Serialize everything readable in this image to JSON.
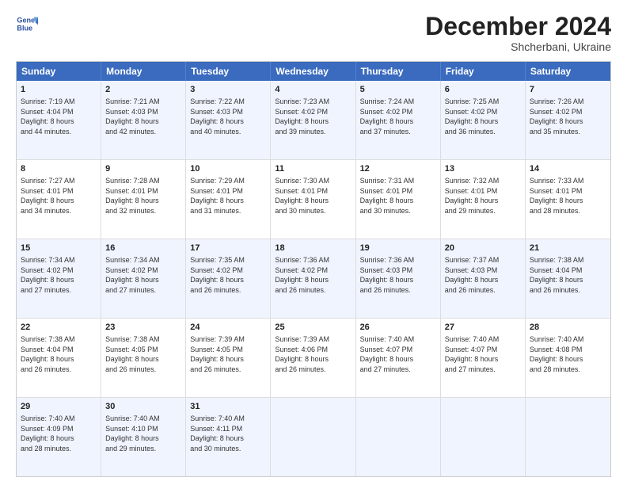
{
  "header": {
    "logo_line1": "General",
    "logo_line2": "Blue",
    "month": "December 2024",
    "location": "Shcherbani, Ukraine"
  },
  "days_of_week": [
    "Sunday",
    "Monday",
    "Tuesday",
    "Wednesday",
    "Thursday",
    "Friday",
    "Saturday"
  ],
  "weeks": [
    [
      {
        "day": "1",
        "lines": [
          "Sunrise: 7:19 AM",
          "Sunset: 4:04 PM",
          "Daylight: 8 hours",
          "and 44 minutes."
        ]
      },
      {
        "day": "2",
        "lines": [
          "Sunrise: 7:21 AM",
          "Sunset: 4:03 PM",
          "Daylight: 8 hours",
          "and 42 minutes."
        ]
      },
      {
        "day": "3",
        "lines": [
          "Sunrise: 7:22 AM",
          "Sunset: 4:03 PM",
          "Daylight: 8 hours",
          "and 40 minutes."
        ]
      },
      {
        "day": "4",
        "lines": [
          "Sunrise: 7:23 AM",
          "Sunset: 4:02 PM",
          "Daylight: 8 hours",
          "and 39 minutes."
        ]
      },
      {
        "day": "5",
        "lines": [
          "Sunrise: 7:24 AM",
          "Sunset: 4:02 PM",
          "Daylight: 8 hours",
          "and 37 minutes."
        ]
      },
      {
        "day": "6",
        "lines": [
          "Sunrise: 7:25 AM",
          "Sunset: 4:02 PM",
          "Daylight: 8 hours",
          "and 36 minutes."
        ]
      },
      {
        "day": "7",
        "lines": [
          "Sunrise: 7:26 AM",
          "Sunset: 4:02 PM",
          "Daylight: 8 hours",
          "and 35 minutes."
        ]
      }
    ],
    [
      {
        "day": "8",
        "lines": [
          "Sunrise: 7:27 AM",
          "Sunset: 4:01 PM",
          "Daylight: 8 hours",
          "and 34 minutes."
        ]
      },
      {
        "day": "9",
        "lines": [
          "Sunrise: 7:28 AM",
          "Sunset: 4:01 PM",
          "Daylight: 8 hours",
          "and 32 minutes."
        ]
      },
      {
        "day": "10",
        "lines": [
          "Sunrise: 7:29 AM",
          "Sunset: 4:01 PM",
          "Daylight: 8 hours",
          "and 31 minutes."
        ]
      },
      {
        "day": "11",
        "lines": [
          "Sunrise: 7:30 AM",
          "Sunset: 4:01 PM",
          "Daylight: 8 hours",
          "and 30 minutes."
        ]
      },
      {
        "day": "12",
        "lines": [
          "Sunrise: 7:31 AM",
          "Sunset: 4:01 PM",
          "Daylight: 8 hours",
          "and 30 minutes."
        ]
      },
      {
        "day": "13",
        "lines": [
          "Sunrise: 7:32 AM",
          "Sunset: 4:01 PM",
          "Daylight: 8 hours",
          "and 29 minutes."
        ]
      },
      {
        "day": "14",
        "lines": [
          "Sunrise: 7:33 AM",
          "Sunset: 4:01 PM",
          "Daylight: 8 hours",
          "and 28 minutes."
        ]
      }
    ],
    [
      {
        "day": "15",
        "lines": [
          "Sunrise: 7:34 AM",
          "Sunset: 4:02 PM",
          "Daylight: 8 hours",
          "and 27 minutes."
        ]
      },
      {
        "day": "16",
        "lines": [
          "Sunrise: 7:34 AM",
          "Sunset: 4:02 PM",
          "Daylight: 8 hours",
          "and 27 minutes."
        ]
      },
      {
        "day": "17",
        "lines": [
          "Sunrise: 7:35 AM",
          "Sunset: 4:02 PM",
          "Daylight: 8 hours",
          "and 26 minutes."
        ]
      },
      {
        "day": "18",
        "lines": [
          "Sunrise: 7:36 AM",
          "Sunset: 4:02 PM",
          "Daylight: 8 hours",
          "and 26 minutes."
        ]
      },
      {
        "day": "19",
        "lines": [
          "Sunrise: 7:36 AM",
          "Sunset: 4:03 PM",
          "Daylight: 8 hours",
          "and 26 minutes."
        ]
      },
      {
        "day": "20",
        "lines": [
          "Sunrise: 7:37 AM",
          "Sunset: 4:03 PM",
          "Daylight: 8 hours",
          "and 26 minutes."
        ]
      },
      {
        "day": "21",
        "lines": [
          "Sunrise: 7:38 AM",
          "Sunset: 4:04 PM",
          "Daylight: 8 hours",
          "and 26 minutes."
        ]
      }
    ],
    [
      {
        "day": "22",
        "lines": [
          "Sunrise: 7:38 AM",
          "Sunset: 4:04 PM",
          "Daylight: 8 hours",
          "and 26 minutes."
        ]
      },
      {
        "day": "23",
        "lines": [
          "Sunrise: 7:38 AM",
          "Sunset: 4:05 PM",
          "Daylight: 8 hours",
          "and 26 minutes."
        ]
      },
      {
        "day": "24",
        "lines": [
          "Sunrise: 7:39 AM",
          "Sunset: 4:05 PM",
          "Daylight: 8 hours",
          "and 26 minutes."
        ]
      },
      {
        "day": "25",
        "lines": [
          "Sunrise: 7:39 AM",
          "Sunset: 4:06 PM",
          "Daylight: 8 hours",
          "and 26 minutes."
        ]
      },
      {
        "day": "26",
        "lines": [
          "Sunrise: 7:40 AM",
          "Sunset: 4:07 PM",
          "Daylight: 8 hours",
          "and 27 minutes."
        ]
      },
      {
        "day": "27",
        "lines": [
          "Sunrise: 7:40 AM",
          "Sunset: 4:07 PM",
          "Daylight: 8 hours",
          "and 27 minutes."
        ]
      },
      {
        "day": "28",
        "lines": [
          "Sunrise: 7:40 AM",
          "Sunset: 4:08 PM",
          "Daylight: 8 hours",
          "and 28 minutes."
        ]
      }
    ],
    [
      {
        "day": "29",
        "lines": [
          "Sunrise: 7:40 AM",
          "Sunset: 4:09 PM",
          "Daylight: 8 hours",
          "and 28 minutes."
        ]
      },
      {
        "day": "30",
        "lines": [
          "Sunrise: 7:40 AM",
          "Sunset: 4:10 PM",
          "Daylight: 8 hours",
          "and 29 minutes."
        ]
      },
      {
        "day": "31",
        "lines": [
          "Sunrise: 7:40 AM",
          "Sunset: 4:11 PM",
          "Daylight: 8 hours",
          "and 30 minutes."
        ]
      },
      {
        "day": "",
        "lines": []
      },
      {
        "day": "",
        "lines": []
      },
      {
        "day": "",
        "lines": []
      },
      {
        "day": "",
        "lines": []
      }
    ]
  ]
}
